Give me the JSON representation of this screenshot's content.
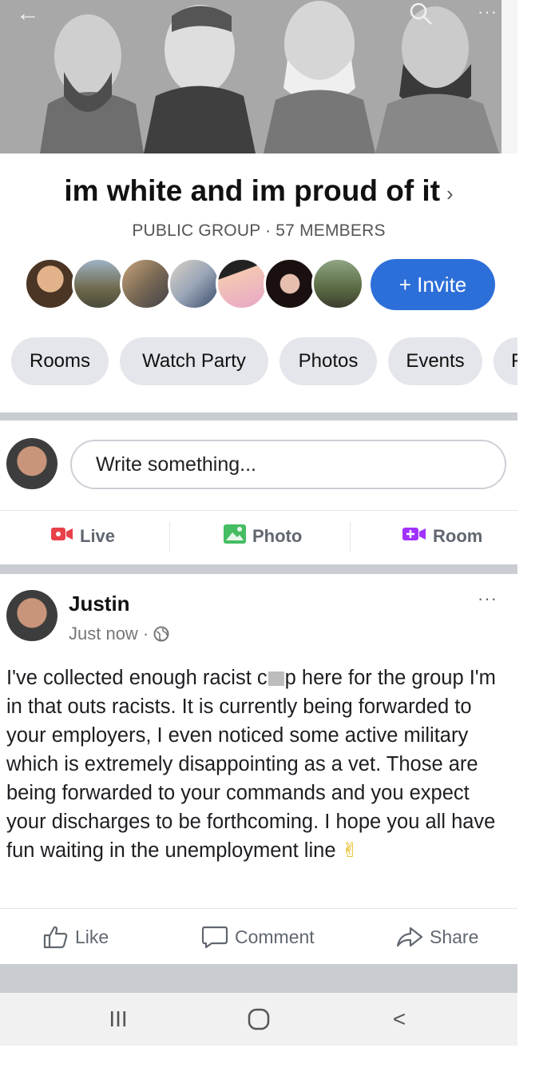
{
  "header": {
    "back_icon": "back-arrow-icon",
    "search_icon": "search-icon",
    "more_icon": "more-icon",
    "back_glyph": "←",
    "more_glyph": "···"
  },
  "group": {
    "title": "im white and im proud of it",
    "chevron": "›",
    "meta": "PUBLIC GROUP · 57 MEMBERS",
    "invite_label": "+ Invite"
  },
  "chips": [
    "Rooms",
    "Watch Party",
    "Photos",
    "Events",
    "F"
  ],
  "composer": {
    "placeholder": "Write something...",
    "actions": [
      {
        "label": "Live",
        "icon": "live-video-icon",
        "color": "#e8414a"
      },
      {
        "label": "Photo",
        "icon": "photo-icon",
        "color": "#45bd62"
      },
      {
        "label": "Room",
        "icon": "room-icon",
        "color": "#a033ff"
      }
    ]
  },
  "post": {
    "author": "Justin",
    "time": "Just now ·",
    "privacy_icon": "globe-icon",
    "more_glyph": "···",
    "text_before": "I've collected enough racist c",
    "text_after": "p here for the group I'm in that outs racists. It is currently being forwarded to your employers, I even noticed some active military which is extremely disappointing as a vet. Those are being forwarded to your commands and you expect your discharges to be forthcoming. I hope you all have fun waiting in the unemployment line",
    "emoji": "✌",
    "actions": [
      "Like",
      "Comment",
      "Share"
    ]
  },
  "nav": {
    "recents_glyph": "III",
    "home_glyph": "O",
    "back_glyph": "<"
  },
  "colors": {
    "accent": "#2d6fd9",
    "chip_bg": "#e4e6eb",
    "divider": "#c9ccd1"
  }
}
